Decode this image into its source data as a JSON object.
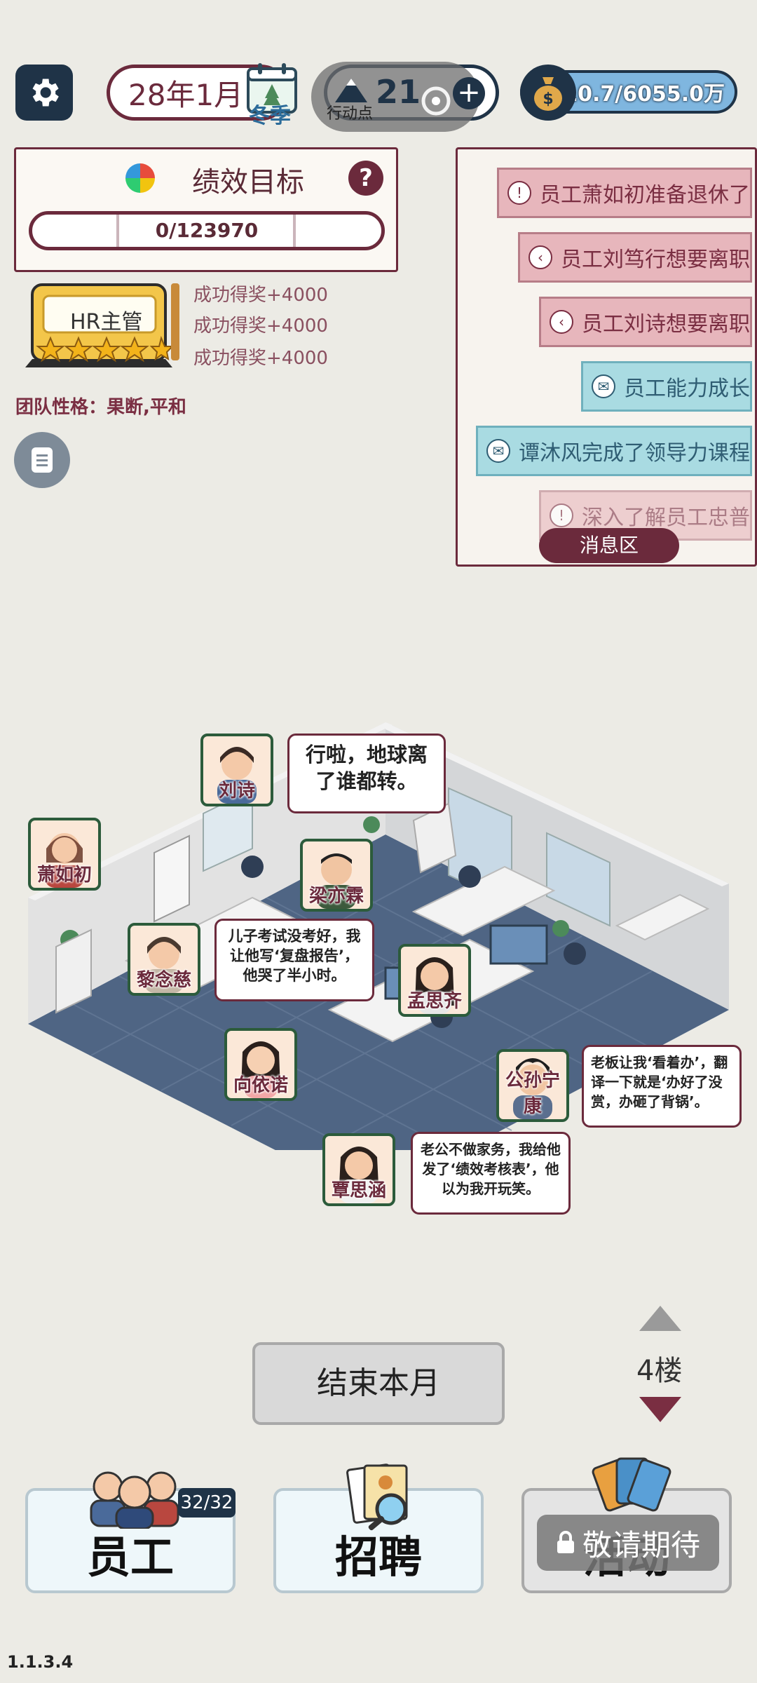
{
  "header": {
    "date": "28年1月",
    "season": "冬季",
    "action_points_value": "21",
    "action_points_label": "行动点",
    "money": "3110.7/6055.0万"
  },
  "performance": {
    "title": "绩效目标",
    "progress_text": "0/123970",
    "help": "?",
    "rank_title": "HR主管",
    "stars": 5,
    "rewards": [
      "成功得奖+4000",
      "成功得奖+4000",
      "成功得奖+4000"
    ],
    "team_character": "团队性格：果断,平和"
  },
  "messages": {
    "tab_label": "消息区",
    "items": [
      {
        "text": "员工萧如初准备退休了",
        "type": "pink",
        "icon": "!"
      },
      {
        "text": "员工刘笃行想要离职",
        "type": "pink",
        "icon": "<"
      },
      {
        "text": "员工刘诗想要离职",
        "type": "pink",
        "icon": "<"
      },
      {
        "text": "员工能力成长",
        "type": "blue",
        "icon": "✉"
      },
      {
        "text": "谭沐风完成了领导力课程",
        "type": "blue",
        "icon": "✉"
      },
      {
        "text": "深入了解员工忠普",
        "type": "pink",
        "icon": "!"
      }
    ]
  },
  "office": {
    "employees": [
      {
        "name": "刘诗"
      },
      {
        "name": "萧如初"
      },
      {
        "name": "梁亦霖"
      },
      {
        "name": "黎念慈"
      },
      {
        "name": "孟思齐"
      },
      {
        "name": "向依诺"
      },
      {
        "name": "公孙宁康"
      },
      {
        "name": "覃思涵"
      }
    ],
    "bubbles": [
      "行啦，地球离了谁都转。",
      "儿子考试没考好，我让他写‘复盘报告’，他哭了半小时。",
      "老板让我‘看着办’，翻译一下就是‘办好了没赏，办砸了背锅’。",
      "老公不做家务，我给他发了‘绩效考核表’，他以为我开玩笑。"
    ]
  },
  "controls": {
    "end_month": "结束本月",
    "floor": "4楼"
  },
  "bottom": {
    "employees_label": "员工",
    "employees_count": "32/32",
    "recruit_label": "招聘",
    "activity_label": "活动",
    "locked_label": "敬请期待"
  },
  "version": "1.1.3.4",
  "colors": {
    "primary": "#6b2a3c",
    "navy": "#1f3347",
    "background": "#ecebe5"
  }
}
